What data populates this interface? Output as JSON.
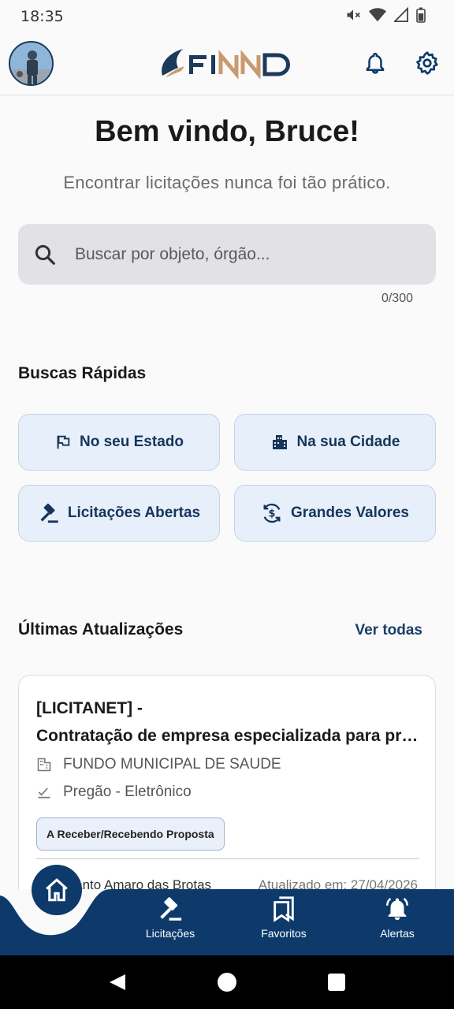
{
  "status_bar": {
    "time": "18:35"
  },
  "header": {
    "logo_text": "FINND"
  },
  "welcome": {
    "title": "Bem vindo, Bruce!",
    "subtitle": "Encontrar licitações nunca foi tão prático."
  },
  "search": {
    "placeholder": "Buscar por objeto, órgão...",
    "value": "",
    "counter": "0/300"
  },
  "quick_search": {
    "title": "Buscas Rápidas",
    "items": [
      {
        "label": "No seu Estado",
        "icon": "flag-icon"
      },
      {
        "label": "Na sua Cidade",
        "icon": "city-icon"
      },
      {
        "label": "Licitações Abertas",
        "icon": "gavel-icon"
      },
      {
        "label": "Grandes Valores",
        "icon": "currency-exchange-icon"
      }
    ]
  },
  "updates": {
    "title": "Últimas Atualizações",
    "see_all": "Ver todas",
    "cards": [
      {
        "title_line1": "[LICITANET] -",
        "title_line2": "Contratação de empresa especializada para prestação de serviços",
        "agency": "FUNDO MUNICIPAL DE SAUDE",
        "modality": "Pregão - Eletrônico",
        "status": "A Receber/Recebendo Proposta",
        "location": "SE - Santo Amaro das Brotas",
        "updated": "Atualizado em: 27/04/2026"
      }
    ]
  },
  "bottom_nav": {
    "items": [
      {
        "label": "Licitações",
        "icon": "gavel-icon"
      },
      {
        "label": "Favoritos",
        "icon": "bookmarks-icon"
      },
      {
        "label": "Alertas",
        "icon": "alarm-bell-icon"
      }
    ]
  },
  "colors": {
    "primary": "#0d3a6b",
    "chip_bg": "#e7effb",
    "accent": "#c89a6e"
  }
}
